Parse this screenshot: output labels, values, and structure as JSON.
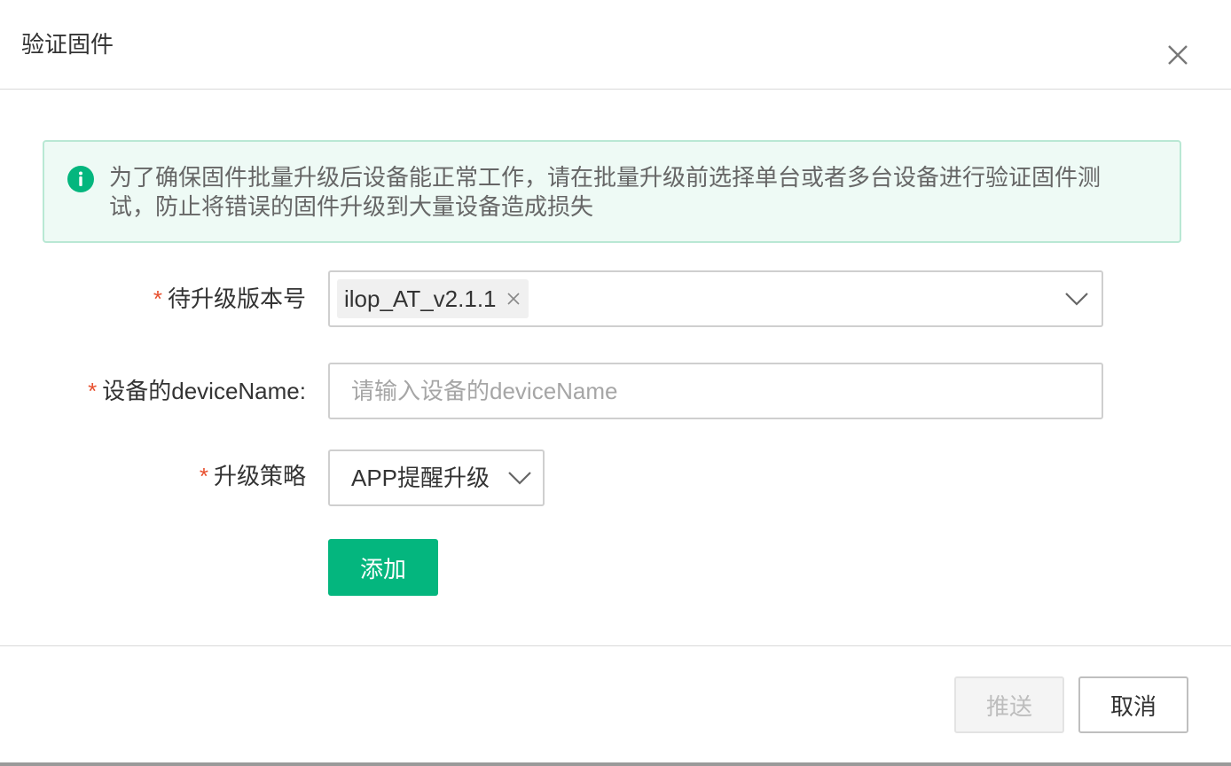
{
  "dialog": {
    "title": "验证固件"
  },
  "alert": {
    "text": "为了确保固件批量升级后设备能正常工作，请在批量升级前选择单台或者多台设备进行验证固件测试，防止将错误的固件升级到大量设备造成损失",
    "icon": "info-icon"
  },
  "form": {
    "required_mark": "*",
    "version": {
      "label": "待升级版本号",
      "selected_tag": "ilop_AT_v2.1.1"
    },
    "device": {
      "label": "设备的deviceName:",
      "value": "",
      "placeholder": "请输入设备的deviceName"
    },
    "strategy": {
      "label": "升级策略",
      "value": "APP提醒升级"
    },
    "add_label": "添加"
  },
  "footer": {
    "push_label": "推送",
    "cancel_label": "取消"
  },
  "colors": {
    "primary": "#04b67e",
    "required": "#e8502f",
    "alert_bg": "#eefaf5",
    "alert_border": "#b9e8d4"
  }
}
